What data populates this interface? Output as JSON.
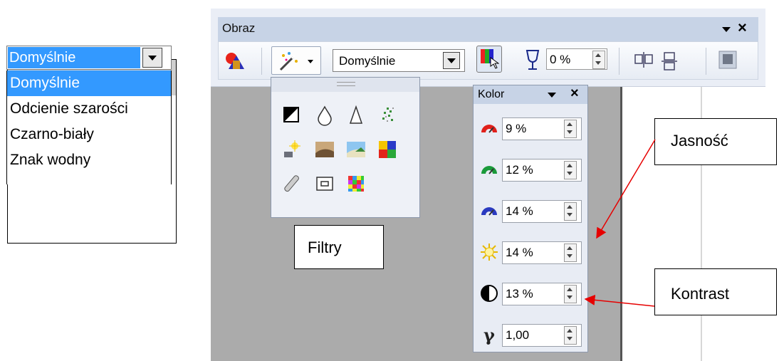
{
  "mode_dropdown": {
    "selected": "Domyślnie",
    "options": [
      "Domyślnie",
      "Odcienie szarości",
      "Czarno-biały",
      "Znak wodny"
    ]
  },
  "obraz_toolbar": {
    "title": "Obraz",
    "menu_icon": "chevron-down-icon",
    "close_label": "×",
    "graphics_mode_value": "Domyślnie",
    "transparency_value": "0 %"
  },
  "filtry_panel": {
    "icons": [
      "invert-icon",
      "smooth-icon",
      "sharpen-icon",
      "remove-noise-icon",
      "solarize-icon",
      "aging-icon",
      "posterize-icon",
      "pop-art-icon",
      "charcoal-icon",
      "relief-icon",
      "mosaic-icon"
    ]
  },
  "kolor_panel": {
    "title": "Kolor",
    "close_label": "×",
    "rows": [
      {
        "icon": "red-gauge-icon",
        "value": "9 %"
      },
      {
        "icon": "green-gauge-icon",
        "value": "12 %"
      },
      {
        "icon": "blue-gauge-icon",
        "value": "14 %"
      },
      {
        "icon": "brightness-sun-icon",
        "value": "14 %"
      },
      {
        "icon": "contrast-circle-icon",
        "value": "13 %"
      },
      {
        "icon": "gamma-icon",
        "value": "1,00"
      }
    ]
  },
  "callouts": {
    "filtry": "Filtry",
    "jasnosc": "Jasność",
    "kontrast": "Kontrast"
  },
  "colors": {
    "selection": "#3399ff",
    "toolbar_title": "#c7d3e6",
    "workspace": "#ababab",
    "arrow": "#e60000"
  }
}
